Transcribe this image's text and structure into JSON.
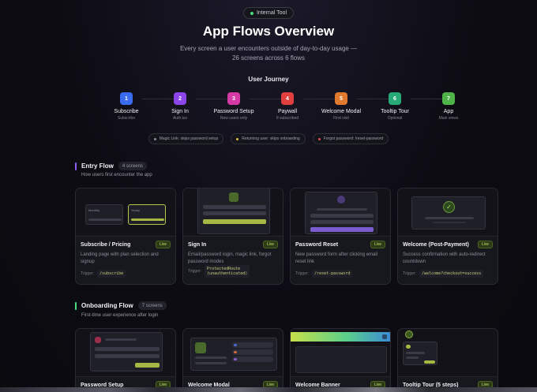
{
  "header": {
    "badge": "Internal Tool",
    "title": "App Flows Overview",
    "subtitle_line1": "Every screen a user encounters outside of day-to-day usage —",
    "subtitle_line2": "26 screens across 6 flows"
  },
  "journey": {
    "label": "User Journey",
    "steps": [
      {
        "num": "1",
        "name": "Subscribe",
        "desc": "Subscribe",
        "color": "#3b6cf0"
      },
      {
        "num": "2",
        "name": "Sign In",
        "desc": "Auth.tsx",
        "color": "#8b45e8"
      },
      {
        "num": "3",
        "name": "Password Setup",
        "desc": "New users only",
        "color": "#d63aa6"
      },
      {
        "num": "4",
        "name": "Paywall",
        "desc": "If subscribed",
        "color": "#e0413f"
      },
      {
        "num": "5",
        "name": "Welcome Modal",
        "desc": "First visit",
        "color": "#e0782d"
      },
      {
        "num": "6",
        "name": "Tooltip Tour",
        "desc": "Optional",
        "color": "#27a978"
      },
      {
        "num": "7",
        "name": "App",
        "desc": "Main views",
        "color": "#4fb349"
      }
    ],
    "branches": [
      {
        "label": "Magic Link: skips password setup",
        "color": "#8a8a9a"
      },
      {
        "label": "Returning user: skips onboarding",
        "color": "#e0c040"
      },
      {
        "label": "Forgot password: /reset-password",
        "color": "#e05050"
      }
    ]
  },
  "sections": {
    "entry": {
      "title": "Entry Flow",
      "count": "4 screens",
      "desc": "How users first encounter the app",
      "bar_color": "#8b5cf6",
      "cards": [
        {
          "title": "Subscribe / Pricing",
          "status": "Live",
          "desc": "Landing page with plan selection and signup",
          "trigger_label": "Trigger:",
          "trigger": "/subscribe",
          "thumb_monthly": "Monthly",
          "thumb_yearly": "Yearly"
        },
        {
          "title": "Sign In",
          "status": "Live",
          "desc": "Email/password login, magic link, forgot password modes",
          "trigger_label": "Trigger:",
          "trigger_line1": "ProtectedRoute",
          "trigger_line2": "(unauthenticated)"
        },
        {
          "title": "Password Reset",
          "status": "Live",
          "desc": "New password form after clicking email reset link",
          "trigger_label": "Trigger:",
          "trigger": "/reset-password"
        },
        {
          "title": "Welcome (Post-Payment)",
          "status": "Live",
          "desc": "Success confirmation with auto-redirect countdown",
          "trigger_label": "Trigger:",
          "trigger": "/welcome?checkout=success"
        }
      ]
    },
    "onboarding": {
      "title": "Onboarding Flow",
      "count": "7 screens",
      "desc": "First-time user experience after login",
      "bar_color": "#4ade80",
      "cards": [
        {
          "title": "Password Setup",
          "status": "Live"
        },
        {
          "title": "Welcome Modal",
          "status": "Live"
        },
        {
          "title": "Welcome Banner",
          "status": "Live"
        },
        {
          "title": "Tooltip Tour (5 steps)",
          "status": "Live"
        }
      ]
    }
  }
}
